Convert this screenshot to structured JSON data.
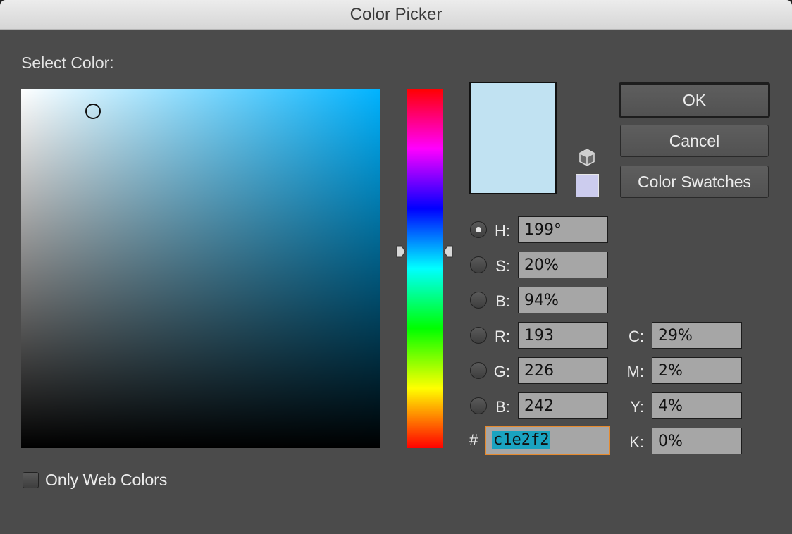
{
  "window": {
    "title": "Color Picker"
  },
  "picker": {
    "select_label": "Select Color:",
    "hue_gradient": [
      "#ff0000",
      "#ff00ff",
      "#0000ff",
      "#00ffff",
      "#00ff00",
      "#ffff00",
      "#ff0000"
    ],
    "field_base_color": "#00b3ff"
  },
  "preview": {
    "new_color": "#c1e2f2",
    "web_safe_color": "#ccccee",
    "icon": "cube-icon"
  },
  "buttons": {
    "ok": "OK",
    "cancel": "Cancel",
    "swatches": "Color Swatches"
  },
  "hsb": [
    {
      "label": "H:",
      "value": "199°",
      "selected": true
    },
    {
      "label": "S:",
      "value": "20%",
      "selected": false
    },
    {
      "label": "B:",
      "value": "94%",
      "selected": false
    }
  ],
  "rgb": [
    {
      "label": "R:",
      "value": "193",
      "selected": false
    },
    {
      "label": "G:",
      "value": "226",
      "selected": false
    },
    {
      "label": "B:",
      "value": "242",
      "selected": false
    }
  ],
  "cmyk": [
    {
      "label": "C:",
      "value": "29%"
    },
    {
      "label": "M:",
      "value": "2%"
    },
    {
      "label": "Y:",
      "value": "4%"
    },
    {
      "label": "K:",
      "value": "0%"
    }
  ],
  "hex": {
    "prefix": "#",
    "value": "c1e2f2"
  },
  "options": {
    "only_web_colors_label": "Only Web Colors",
    "only_web_colors_checked": false
  }
}
